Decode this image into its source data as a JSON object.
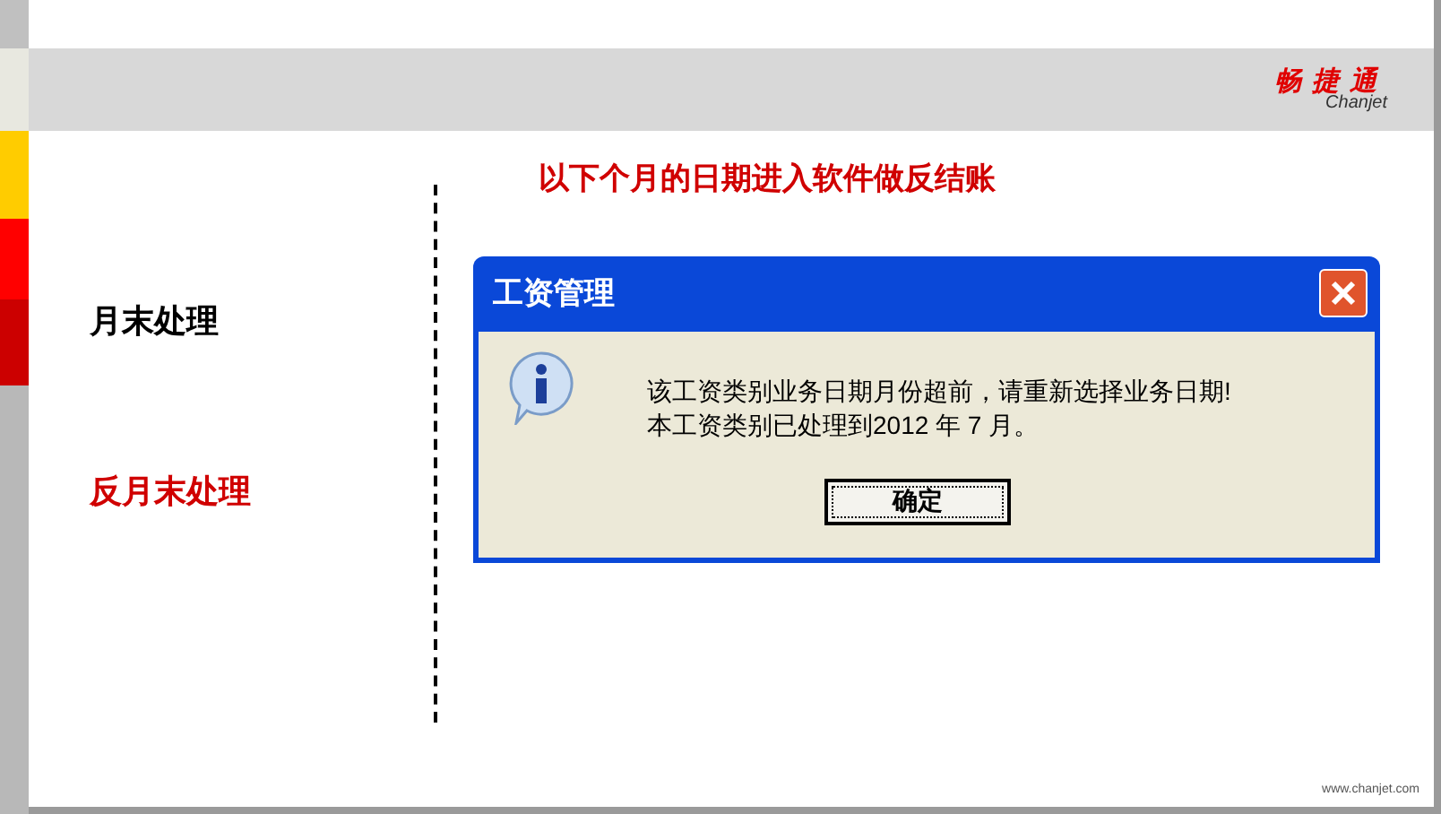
{
  "logo": {
    "name": "畅捷通",
    "subtitle": "Chanjet"
  },
  "heading": "以下个月的日期进入软件做反结账",
  "side_items": [
    {
      "label": "月末处理",
      "selected": false
    },
    {
      "label": "反月末处理",
      "selected": true
    }
  ],
  "dialog": {
    "title": "工资管理",
    "message": [
      "该工资类别业务日期月份超前，请重新选择业务日期!",
      "本工资类别已处理到2012 年 7 月。"
    ],
    "button": "确定"
  },
  "footer": "www.chanjet.com"
}
